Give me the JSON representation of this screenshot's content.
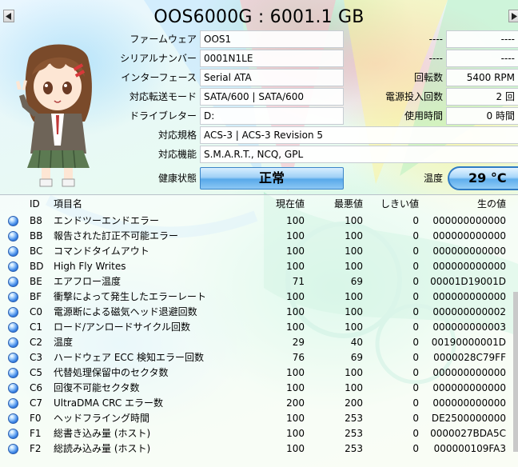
{
  "title": "OOS6000G : 6001.1 GB",
  "left_panel": [
    {
      "label": "ファームウェア",
      "value": "OOS1"
    },
    {
      "label": "シリアルナンバー",
      "value": "0001N1LE"
    },
    {
      "label": "インターフェース",
      "value": "Serial ATA"
    },
    {
      "label": "対応転送モード",
      "value": "SATA/600 | SATA/600"
    },
    {
      "label": "ドライブレター",
      "value": "D:"
    },
    {
      "label": "対応規格",
      "value": "ACS-3 | ACS-3 Revision 5"
    },
    {
      "label": "対応機能",
      "value": "S.M.A.R.T., NCQ, GPL"
    }
  ],
  "right_panel": [
    {
      "label": "----",
      "value": "----"
    },
    {
      "label": "----",
      "value": "----"
    },
    {
      "label": "回転数",
      "value": "5400 RPM"
    },
    {
      "label": "電源投入回数",
      "value": "2 回"
    },
    {
      "label": "使用時間",
      "value": "0 時間"
    }
  ],
  "health": {
    "label": "健康状態",
    "value": "正常"
  },
  "temperature": {
    "label": "温度",
    "value": "29 °C"
  },
  "table": {
    "headers": {
      "id": "ID",
      "name": "項目名",
      "current": "現在値",
      "worst": "最悪値",
      "threshold": "しきい値",
      "raw": "生の値"
    },
    "rows": [
      {
        "id": "B8",
        "name": "エンドツーエンドエラー",
        "current": "100",
        "worst": "100",
        "threshold": "0",
        "raw": "000000000000"
      },
      {
        "id": "BB",
        "name": "報告された訂正不可能エラー",
        "current": "100",
        "worst": "100",
        "threshold": "0",
        "raw": "000000000000"
      },
      {
        "id": "BC",
        "name": "コマンドタイムアウト",
        "current": "100",
        "worst": "100",
        "threshold": "0",
        "raw": "000000000000"
      },
      {
        "id": "BD",
        "name": "High Fly Writes",
        "current": "100",
        "worst": "100",
        "threshold": "0",
        "raw": "000000000000"
      },
      {
        "id": "BE",
        "name": "エアフロー温度",
        "current": "71",
        "worst": "69",
        "threshold": "0",
        "raw": "00001D19001D"
      },
      {
        "id": "BF",
        "name": "衝撃によって発生したエラーレート",
        "current": "100",
        "worst": "100",
        "threshold": "0",
        "raw": "000000000000"
      },
      {
        "id": "C0",
        "name": "電源断による磁気ヘッド退避回数",
        "current": "100",
        "worst": "100",
        "threshold": "0",
        "raw": "000000000002"
      },
      {
        "id": "C1",
        "name": "ロード/アンロードサイクル回数",
        "current": "100",
        "worst": "100",
        "threshold": "0",
        "raw": "000000000003"
      },
      {
        "id": "C2",
        "name": "温度",
        "current": "29",
        "worst": "40",
        "threshold": "0",
        "raw": "00190000001D"
      },
      {
        "id": "C3",
        "name": "ハードウェア ECC 検知エラー回数",
        "current": "76",
        "worst": "69",
        "threshold": "0",
        "raw": "0000028C79FF"
      },
      {
        "id": "C5",
        "name": "代替処理保留中のセクタ数",
        "current": "100",
        "worst": "100",
        "threshold": "0",
        "raw": "000000000000"
      },
      {
        "id": "C6",
        "name": "回復不可能セクタ数",
        "current": "100",
        "worst": "100",
        "threshold": "0",
        "raw": "000000000000"
      },
      {
        "id": "C7",
        "name": "UltraDMA CRC エラー数",
        "current": "200",
        "worst": "200",
        "threshold": "0",
        "raw": "000000000000"
      },
      {
        "id": "F0",
        "name": "ヘッドフライング時間",
        "current": "100",
        "worst": "253",
        "threshold": "0",
        "raw": "DE2500000000"
      },
      {
        "id": "F1",
        "name": "総書き込み量 (ホスト)",
        "current": "100",
        "worst": "253",
        "threshold": "0",
        "raw": "0000027BDA5C"
      },
      {
        "id": "F2",
        "name": "総読み込み量 (ホスト)",
        "current": "100",
        "worst": "253",
        "threshold": "0",
        "raw": "000000109FA3"
      }
    ]
  }
}
